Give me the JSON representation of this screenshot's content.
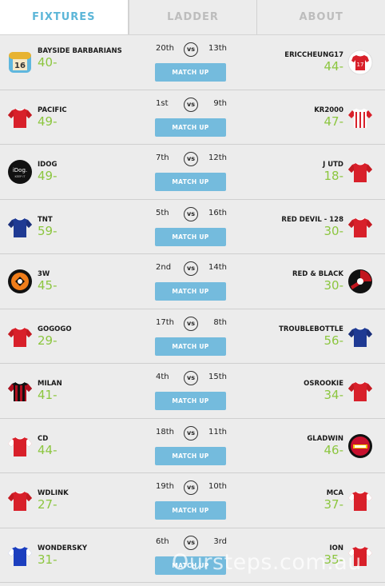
{
  "tabs": [
    {
      "label": "FIXTURES",
      "active": true
    },
    {
      "label": "LADDER",
      "active": false
    },
    {
      "label": "ABOUT",
      "active": false
    }
  ],
  "vs_label": "vs",
  "button_label": "MATCH UP",
  "fixtures": [
    {
      "home": {
        "name": "BAYSIDE BARBARIANS",
        "score": "40-",
        "rank": "20th",
        "jersey": "bayside-badge"
      },
      "away": {
        "name": "ERICCHEUNG17",
        "score": "44-",
        "rank": "13th",
        "jersey": "red-white-17"
      }
    },
    {
      "home": {
        "name": "PACIFIC",
        "score": "49-",
        "rank": "1st",
        "jersey": "red"
      },
      "away": {
        "name": "KR2000",
        "score": "47-",
        "rank": "9th",
        "jersey": "red-white-stripes"
      }
    },
    {
      "home": {
        "name": "IDOG",
        "score": "49-",
        "rank": "7th",
        "jersey": "idog-logo"
      },
      "away": {
        "name": "J UTD",
        "score": "18-",
        "rank": "12th",
        "jersey": "red"
      }
    },
    {
      "home": {
        "name": "TNT",
        "score": "59-",
        "rank": "5th",
        "jersey": "navy"
      },
      "away": {
        "name": "RED DEVIL - 128",
        "score": "30-",
        "rank": "16th",
        "jersey": "red"
      }
    },
    {
      "home": {
        "name": "3W",
        "score": "45-",
        "rank": "2nd",
        "jersey": "orange-badge"
      },
      "away": {
        "name": "RED & BLACK",
        "score": "30-",
        "rank": "14th",
        "jersey": "milan-badge"
      }
    },
    {
      "home": {
        "name": "GOGOGO",
        "score": "29-",
        "rank": "17th",
        "jersey": "red"
      },
      "away": {
        "name": "TROUBLEBOTTLE",
        "score": "56-",
        "rank": "8th",
        "jersey": "navy"
      }
    },
    {
      "home": {
        "name": "MILAN",
        "score": "41-",
        "rank": "4th",
        "jersey": "red-black-stripes"
      },
      "away": {
        "name": "OSROOKIE",
        "score": "34-",
        "rank": "15th",
        "jersey": "red"
      }
    },
    {
      "home": {
        "name": "CD",
        "score": "44-",
        "rank": "18th",
        "jersey": "red-white-sleeves"
      },
      "away": {
        "name": "GLADWIN",
        "score": "46-",
        "rank": "11th",
        "jersey": "arsenal-badge"
      }
    },
    {
      "home": {
        "name": "WDLINK",
        "score": "27-",
        "rank": "19th",
        "jersey": "red"
      },
      "away": {
        "name": "MCA",
        "score": "37-",
        "rank": "10th",
        "jersey": "red-white-sleeves"
      }
    },
    {
      "home": {
        "name": "WONDERSKY",
        "score": "31-",
        "rank": "6th",
        "jersey": "blue"
      },
      "away": {
        "name": "ION",
        "score": "35-",
        "rank": "3rd",
        "jersey": "red-white-sleeves"
      }
    }
  ],
  "watermark": "Oursteps.com.au",
  "colors": {
    "accent": "#74bbdd",
    "active_tab": "#5cb6d8",
    "score": "#8cc63f"
  }
}
